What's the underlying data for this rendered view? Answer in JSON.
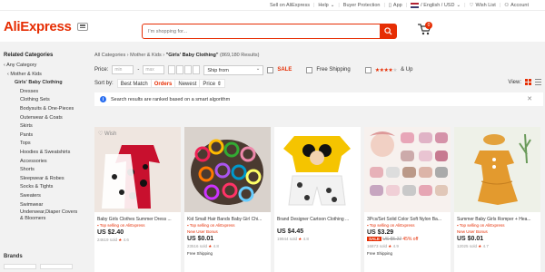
{
  "topbar": {
    "sell": "Sell on AliExpress",
    "help": "Help",
    "buyer_protection": "Buyer Protection",
    "app": "App",
    "locale": "/ English / USD",
    "wishlist": "Wish List",
    "account": "Account"
  },
  "header": {
    "logo": "AliExpress",
    "search_placeholder": "I'm shopping for...",
    "cart_count": "0"
  },
  "sidebar": {
    "title": "Related Categories",
    "any": "Any Category",
    "parent": "Mother & Kids",
    "current": "Girls' Baby Clothing",
    "items": [
      "Dresses",
      "Clothing Sets",
      "Bodysuits & One-Pieces",
      "Outerwear & Coats",
      "Skirts",
      "Pants",
      "Tops",
      "Hoodies & Sweatshirts",
      "Accessories",
      "Shorts",
      "Sleepwear & Robes",
      "Socks & Tights",
      "Sweaters",
      "Swimwear"
    ],
    "last_item": "Underwear,Diaper Covers & Bloomers",
    "brands_title": "Brands"
  },
  "main": {
    "breadcrumb": {
      "all": "All Categories",
      "sep": "›",
      "parent": "Mother & Kids",
      "current": "\"Girls' Baby Clothing\"",
      "count": "(869,180 Results)"
    },
    "filters": {
      "price_label": "Price:",
      "min_placeholder": "min",
      "max_placeholder": "max",
      "dash": "-",
      "ship_from": "Ship from",
      "sale": "SALE",
      "free_shipping": "Free Shipping",
      "rating": "& Up"
    },
    "sort": {
      "label": "Sort by:",
      "options": [
        "Best Match",
        "Orders",
        "Newest",
        "Price ⇕"
      ],
      "active_index": 1,
      "view_label": "View:"
    },
    "notice": "Search results are ranked based on a smart algorithm"
  },
  "products": [
    {
      "title": "Baby Girls Clothes Summer Dress ...",
      "tag": "Top selling on AliExpress",
      "price": "US $2.40",
      "sold": "24619 sold",
      "rating": "4.6",
      "wish": "Wish"
    },
    {
      "title": "Kid Small Hair Bands Baby Girl Chi...",
      "tag": "Top selling on AliExpress",
      "promo": "New User Bonus",
      "price": "US $0.01",
      "sold": "23516 sold",
      "rating": "4.8",
      "ship": "Free Shipping"
    },
    {
      "title": "Brand Designer Cartoon Clothing ...",
      "price": "US $4.45",
      "sold": "19944 sold",
      "rating": "4.8"
    },
    {
      "title": "3Pcs/Set Solid Color Soft Nylon Ba...",
      "tag": "Top selling on AliExpress",
      "price": "US $3.29",
      "sale": "SALE",
      "old_price": "US $5.22",
      "off": "45% off",
      "sold": "16873 sold",
      "rating": "4.9",
      "ship": "Free Shipping"
    },
    {
      "title": "Summer Baby Girls Romper + Hea...",
      "tag": "Top selling on AliExpress",
      "promo": "New User Bonus",
      "price": "US $0.01",
      "sold": "12025 sold",
      "rating": "4.7"
    }
  ],
  "colors": {
    "brand": "#e62e04",
    "info": "#2a6ef0"
  }
}
